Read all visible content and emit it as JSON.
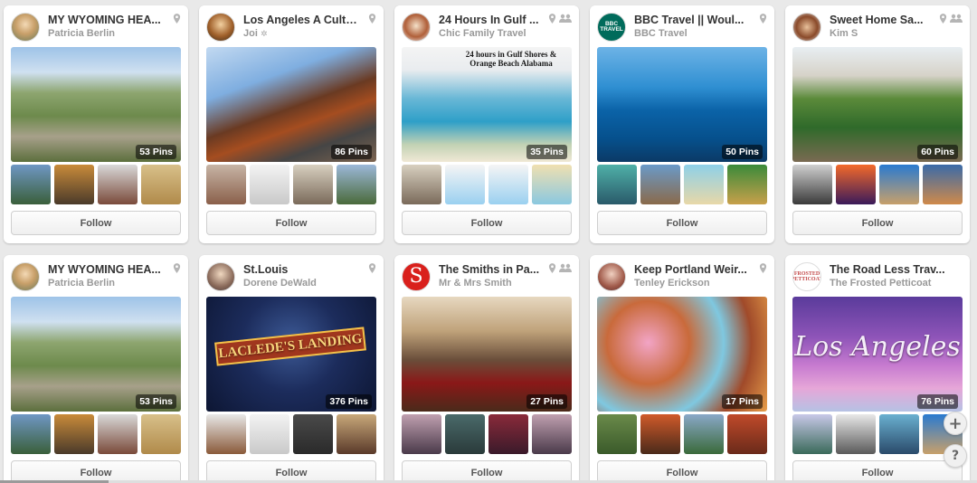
{
  "follow_label": "Follow",
  "boards": [
    {
      "title": "MY WYOMING HEA...",
      "owner": "Patricia Berlin",
      "pins": "53 Pins",
      "avatar": "avatar-woman-blonde",
      "cover": "wyoming-valley-photo",
      "badges": [
        "map-pin-icon"
      ]
    },
    {
      "title": "Los Angeles A Cultu...",
      "owner": "Joi",
      "pins": "86 Pins",
      "avatar": "avatar-woman",
      "cover": "angels-flight-trolley-photo",
      "badges": [
        "map-pin-icon"
      ]
    },
    {
      "title": "24 Hours In Gulf ...",
      "owner": "Chic Family Travel",
      "pins": "35 Pins",
      "avatar": "avatar-woman-hat",
      "cover": "gulf-shores-pool-photo",
      "badges": [
        "map-pin-icon",
        "group-icon"
      ],
      "cover_text": "24 hours in Gulf Shores & Orange Beach Alabama"
    },
    {
      "title": "BBC Travel || Woul...",
      "owner": "BBC Travel",
      "pins": "50 Pins",
      "avatar": "bbc-travel-logo",
      "avatar_text": "BBC TRAVEL",
      "cover": "underwater-hotel-photo",
      "badges": [
        "map-pin-icon"
      ]
    },
    {
      "title": "Sweet Home Sa...",
      "owner": "Kim S",
      "pins": "60 Pins",
      "avatar": "avatar-woman-sunglasses",
      "cover": "garden-house-photo",
      "badges": [
        "map-pin-icon",
        "group-icon"
      ]
    },
    {
      "title": "MY WYOMING HEA...",
      "owner": "Patricia Berlin",
      "pins": "53 Pins",
      "avatar": "avatar-woman-blonde",
      "cover": "wyoming-valley-photo",
      "badges": [
        "map-pin-icon"
      ]
    },
    {
      "title": "St.Louis",
      "owner": "Dorene DeWald",
      "pins": "376 Pins",
      "avatar": "avatar-woman-smiling",
      "cover": "lacledes-landing-sign-photo",
      "badges": [
        "map-pin-icon"
      ],
      "cover_text": "LACLEDE'S LANDING"
    },
    {
      "title": "The Smiths in Pa...",
      "owner": "Mr & Mrs Smith",
      "pins": "27 Pins",
      "avatar": "mr-mrs-smith-logo",
      "avatar_text": "S",
      "cover": "grand-staircase-photo",
      "badges": [
        "map-pin-icon",
        "group-icon"
      ]
    },
    {
      "title": "Keep Portland Weir...",
      "owner": "Tenley Erickson",
      "pins": "17 Pins",
      "avatar": "avatar-woman-red",
      "cover": "donuts-photo",
      "badges": [
        "map-pin-icon"
      ]
    },
    {
      "title": "The Road Less Trav...",
      "owner": "The Frosted Petticoat",
      "pins": "76 Pins",
      "avatar": "frosted-petticoat-logo",
      "avatar_text": "FROSTED PETTICOAT",
      "cover": "los-angeles-palms-photo",
      "badges": [],
      "cover_text": "Los Angeles"
    }
  ],
  "floating": {
    "add": "+",
    "help": "?"
  }
}
